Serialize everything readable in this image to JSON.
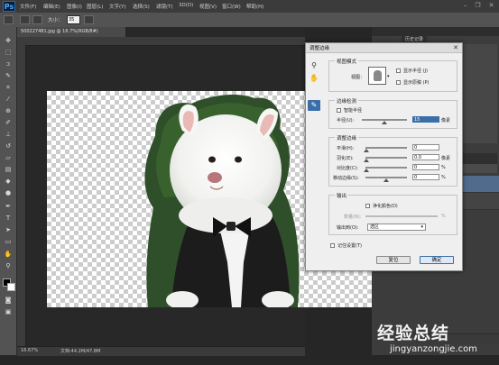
{
  "app": {
    "logo": "Ps"
  },
  "menubar": {
    "items": [
      "文件(F)",
      "编辑(E)",
      "图像(I)",
      "图层(L)",
      "文字(Y)",
      "选择(S)",
      "滤镜(T)",
      "3D(D)",
      "视图(V)",
      "窗口(W)",
      "帮助(H)"
    ],
    "min": "–",
    "restore": "❐",
    "close": "✕"
  },
  "options": {
    "size_label": "大小：",
    "size_value": "35"
  },
  "document": {
    "tab_title": "500227481.jpg @ 16.7%(RGB/8#)",
    "zoom": "16.67%",
    "doc_info": "文档:44.2M/47.8M"
  },
  "panels": {
    "history_tab": "历史记录"
  },
  "dialog": {
    "title": "调整边缘",
    "view_mode": {
      "group_title": "视图模式",
      "view_label": "视图：",
      "show_radius": "显示半径 (J)",
      "show_original": "显示原稿 (P)"
    },
    "edge_detection": {
      "group_title": "边缘检测",
      "smart_radius": "智能半径",
      "radius_label": "半径(U):",
      "radius_value": "15",
      "radius_unit": "像素"
    },
    "adjust_edge": {
      "group_title": "调整边缘",
      "smooth_label": "平滑(H):",
      "smooth_value": "0",
      "feather_label": "羽化(E):",
      "feather_value": "0.0",
      "feather_unit": "像素",
      "contrast_label": "对比度(C):",
      "contrast_value": "0",
      "contrast_unit": "%",
      "shift_label": "移动边缘(S):",
      "shift_value": "0",
      "shift_unit": "%"
    },
    "output": {
      "group_title": "输出",
      "decontaminate": "净化颜色(D)",
      "amount_label": "数量(N):",
      "amount_unit": "%",
      "output_to_label": "输出到(O):",
      "output_to_value": "选区"
    },
    "remember": "记住设置(T)",
    "cancel": "复位",
    "ok": "确定"
  },
  "watermark": {
    "main": "经验总结",
    "sub": "jingyanzongjie.com"
  },
  "colors": {
    "accent": "#3a6ea8",
    "chrome_dark": "#262626",
    "panel": "#535353"
  }
}
